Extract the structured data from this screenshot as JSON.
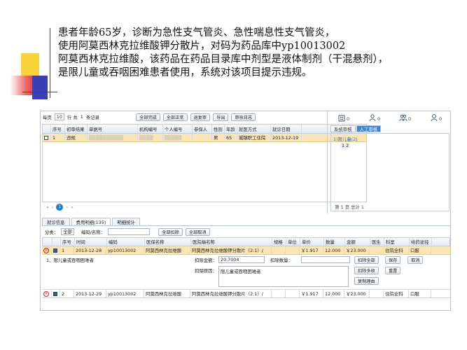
{
  "paragraph": {
    "line1": "患者年龄65岁，诊断为急性支气管炎、急性喘息性支气管炎，",
    "line2": "使用阿莫西林克拉维酸钾分散片，对码为药品库中yp10013002",
    "line3": "阿莫西林克拉维酸，该药品在药品目录库中剂型是液体制剂（干混悬剂），",
    "line4": "是限儿童或吞咽困难患者使用，系统对该项目提示违规。"
  },
  "toolbar": {
    "per_page_label": "每页",
    "per_page_value": "10",
    "total_label": "行 共",
    "total_value": "1",
    "records_label": "条记录",
    "buttons": [
      "全部完成",
      "全部正常",
      "退复审",
      "导出",
      "审核日志"
    ]
  },
  "stats": [
    {
      "icon": "building-icon",
      "value": "0"
    },
    {
      "icon": "doctor-icon",
      "value": "0"
    },
    {
      "icon": "multi-user-icon",
      "value": "0"
    },
    {
      "icon": "user-icon",
      "value": "0"
    }
  ],
  "main_table": {
    "headers": [
      "",
      "序号",
      "初审结果",
      "单据号",
      "机构编号",
      "个人编号",
      "参保人",
      "性别",
      "年龄",
      "就医方式",
      "就诊日期"
    ],
    "row": [
      "",
      "1",
      "违规",
      "",
      "",
      "",
      "",
      "男",
      "65",
      "城镇职工住院",
      "2013-12-19"
    ]
  },
  "pager": {
    "first": "«",
    "prev": "‹",
    "page": "1",
    "next": "›",
    "last": "»",
    "info": "第 1 页 总计 1"
  },
  "right_panel": {
    "tabs": [
      "系统审核",
      "人工审核"
    ],
    "tree_item": "1)限儿童(2)",
    "tree_values": "1  2"
  },
  "lower": {
    "tabs": [
      "就诊信息",
      "费用明细(135)",
      "明细统计"
    ],
    "filter_label": "分类：",
    "filter_value": "全部",
    "search_label": "编码/名称：",
    "filter_buttons": [
      "全部扣除",
      "全部取消"
    ],
    "headers": [
      "",
      "",
      "序号",
      "时间",
      "编码",
      "医保名称",
      "医院端名称",
      "规格",
      "单位",
      "单价",
      "数量",
      "金额",
      "医生",
      "科室",
      "给药途径"
    ],
    "rows": [
      [
        "",
        "",
        "1",
        "2013-12-28",
        "yp10013002",
        "阿莫西林克拉维酸",
        "阿莫西林克拉维酸钾分散片（2:1）/",
        "",
        "",
        "￥1.917",
        "12.000",
        "￥23.000",
        "",
        "住院全科",
        "口服"
      ],
      [
        "",
        "",
        "2",
        "2013-12-29",
        "yp10013002",
        "阿莫西林克拉维酸",
        "阿莫西林克拉维酸钾分散片（2:1）/",
        "",
        "",
        "￥1.917",
        "12.000",
        "￥23.000",
        "",
        "住院全科",
        "口服"
      ]
    ],
    "detail": {
      "reason_note": "1、限儿童或吞咽困难者",
      "deduct_amount_label": "扣除金额：",
      "deduct_amount_value": "20.7004",
      "deduct_qty_label": "扣除数量：",
      "deduct_reason_label": "扣除原因：",
      "deduct_reason_value": "限儿童或吞咽困难者",
      "buttons_row1": [
        "扣除全部",
        "保存",
        "取消"
      ],
      "buttons_row2": [
        "扣除多收",
        "重置"
      ],
      "buttons_row3": [
        "复制理由"
      ]
    }
  }
}
